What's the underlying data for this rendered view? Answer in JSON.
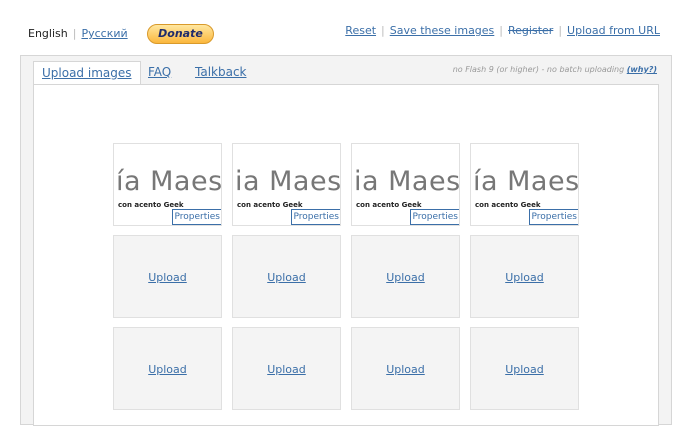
{
  "languages": {
    "current": "English",
    "other": "Русский"
  },
  "donate_label": "Donate",
  "top_links": {
    "reset": "Reset",
    "save": "Save these images",
    "register": "Register",
    "upload_url": "Upload from URL"
  },
  "tabs": [
    {
      "label": "Upload images"
    },
    {
      "label": "FAQ"
    },
    {
      "label": "Talkback"
    }
  ],
  "note": {
    "text": "no Flash 9 (or higher) - no batch uploading",
    "link": "(why?)"
  },
  "thumbnails": [
    {
      "big_text": "ía Maes",
      "small_text": "con acento Geek",
      "properties": "Properties"
    },
    {
      "big_text": "ia Maes",
      "small_text": "con acento Geek",
      "properties": "Properties"
    },
    {
      "big_text": "ia Maes",
      "small_text": "con acento Geek",
      "properties": "Properties"
    },
    {
      "big_text": "ía Maes",
      "small_text": "con acento Geek",
      "properties": "Properties"
    }
  ],
  "upload_label": "Upload"
}
